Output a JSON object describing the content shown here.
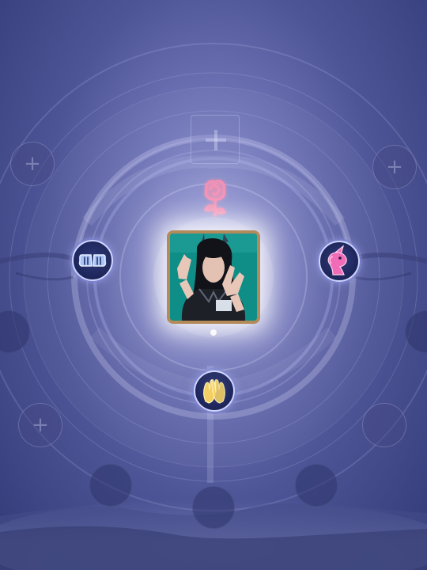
{
  "screen": {
    "title": "",
    "theme_colors": {
      "background_dark": "#313a76",
      "background_light": "#9a9fd8",
      "ring": "#c5c9f3",
      "frame_gold": "#b38a59",
      "emote_ring": "#cfd5ff",
      "rose_pink": "#f58bb0",
      "unicorn_pink": "#f06bb8",
      "hands_gold": "#f3cf63",
      "fist_blue": "#a9c4f5"
    }
  },
  "center": {
    "portrait_icon": "player-photo-icon"
  },
  "emote_wheel": {
    "top": {
      "icon": "rose-icon"
    },
    "left": {
      "icon": "fist-bump-icon"
    },
    "right": {
      "icon": "unicorn-icon"
    },
    "bottom": {
      "icon": "raised-hands-icon"
    },
    "top_add": {
      "icon": "plus-icon"
    }
  },
  "outer_slots": [
    {
      "icon": "plus-icon"
    },
    {
      "icon": "plus-icon"
    },
    {
      "icon": "plus-icon"
    },
    {
      "icon": "plus-icon"
    }
  ],
  "bottom_slots": [
    {
      "icon": "empty-slot"
    },
    {
      "icon": "empty-slot"
    },
    {
      "icon": "empty-slot"
    },
    {
      "icon": "empty-slot"
    },
    {
      "icon": "empty-slot"
    },
    {
      "icon": "empty-slot"
    }
  ]
}
